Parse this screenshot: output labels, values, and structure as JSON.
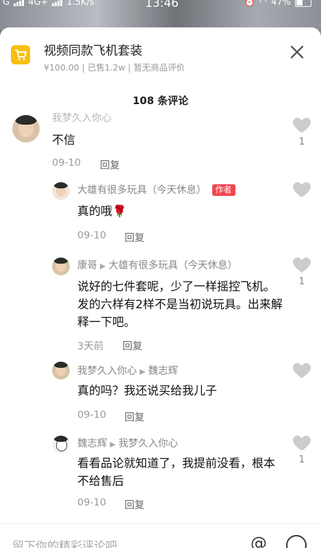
{
  "status_bar": {
    "carrier": "G",
    "network": "4G+",
    "speed": "1.5K/s",
    "time": "13:46",
    "battery": "47%"
  },
  "product": {
    "title": "视频同款飞机套装",
    "meta": "¥100.00 | 已售1.2w | 暂无商品评价"
  },
  "comment_count": "108 条评论",
  "comments": [
    {
      "name": "我梦久入你心",
      "text": "不信",
      "date": "09-10",
      "reply": "回复",
      "likes": "1"
    },
    {
      "name": "大雄有很多玩具（今天休息）",
      "badge": "作者",
      "text": "真的哦🌹",
      "date": "09-10",
      "reply": "回复",
      "likes": ""
    },
    {
      "name": "康哥",
      "reply_to": "大雄有很多玩具（今天休息）",
      "text": "说好的七件套呢，少了一样摇控飞机。发的六样有2样不是当初说玩具。出来解释一下吧。",
      "date": "3天前",
      "reply": "回复",
      "likes": "1"
    },
    {
      "name": "我梦久入你心",
      "reply_to": "魏志辉",
      "text": "真的吗？我还说买给我儿子",
      "date": "09-10",
      "reply": "回复",
      "likes": ""
    },
    {
      "name": "魏志辉",
      "reply_to": "我梦久入你心",
      "text": "看看品论就知道了，我提前没看，根本不给售后",
      "date": "09-10",
      "reply": "回复",
      "likes": "1"
    }
  ],
  "input": {
    "placeholder": "留下你的精彩评论吧"
  },
  "icons": {
    "cart": "cart-icon",
    "close": "close-icon",
    "heart": "heart-icon",
    "at": "at-icon",
    "emoji": "emoji-icon"
  },
  "colors": {
    "accent": "#f6bf12",
    "author_badge": "#f0484f",
    "heart": "#cccccc"
  }
}
